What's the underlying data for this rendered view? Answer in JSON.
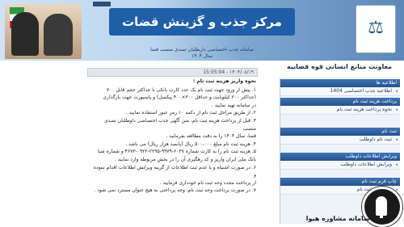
{
  "banner": {
    "title": "مرکز جذب و گزینش قضات",
    "subtitle_line1": "سامانه جذب اختصاصی دارطلبان تصدی منصب قضا",
    "subtitle_line2": "سال ۱۴۰۴",
    "logo_icon": "scales-emblem-icon"
  },
  "org_title": "معاونت منابع انسانی قوه قضاییه",
  "date_strip": "۱۴۰۴/۰۸/۱۹  -  15:05:04",
  "content": {
    "heading": "نحوه واریز هزینه ثبت نام :",
    "lines": [
      "۱. پیش از ورود جهت ثبت نام یک عدد کارت بانکی با حداکثر حجم قابل ۷۰۰",
      "(حداکثر ۲۰۰ کیلوبایت و حداقل ۳۰۰×۴۰۰ پیکسل) و پاسپورت جهت بارگذاری",
      "در سامانه تهیه نمایید .",
      "۲. از طریق مراحل ثبت نام از دکمه ۱۰ رمز عبور استفاده نمایید .",
      "۳. قبل از پرداخت هزینه ثبت نام، متن آگهی جذب اختصاصی داوطلبان تصدی منصب",
      "قضا، سال ۱۴۰۴ را به دقت مطالعه بفرمایید .",
      "۴. هزینه ثبت نام مبلغ ۵۰۰،۰۰۰ ریال (پانصد هزار ریال) می باشد .",
      "۵. هزینه ثبت نام را به کارت شماره ۶۰۳۷-۹۹۷۹-۲۲۹۵-۰۹۲۲-۴۶۷۳ و شماره شبا",
      "بانک ملی ایران واریز و کد رهگیری آن را در بخش مربوطه وارد نمایید .",
      "۶. در صورت اشتباه و یا عدم ثبت اطلاعات از گزینه ویرایش اطلاعات اقدام نموده و",
      "از پرداخت مجدد وجه ثبت نام خودداری فرمایید .",
      "۷. در صورت پرداخت وجه ثبت نام، وجه پرداختی به هیچ عنوان مسترد نمی شود ."
    ]
  },
  "sidebar": {
    "sections": [
      {
        "title": "اطلاعیه ها",
        "items": [
          "اطلاعیه جذب اختصاصی 1404"
        ]
      },
      {
        "title": "پرداخت هزینه ثبت نام",
        "items": [
          "نحوه پرداخت هزینه ثبت نام"
        ]
      },
      {
        "title": "ثبت نام",
        "items": [
          "ثبت نام داوطلب"
        ]
      },
      {
        "title": "ویرایش اطلاعات داوطلب",
        "items": [
          "ویرایش اطلاعات داوطلب"
        ]
      },
      {
        "title": "چاپ فرم ثبت نام",
        "items": [
          "چاپ فرم ثبت نام"
        ]
      }
    ]
  },
  "watermark": {
    "text": "سامانه مشاوره هیوا",
    "icon": "pen-nib-icon"
  }
}
